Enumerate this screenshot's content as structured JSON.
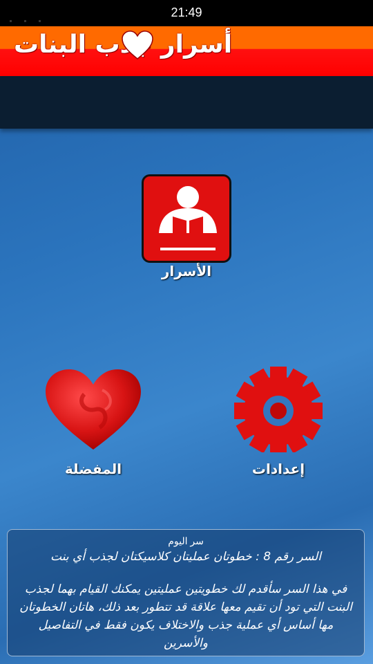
{
  "status_bar": {
    "time": "21:49"
  },
  "app": {
    "title": "أسرار جذب البنات",
    "title_icon": "heart-icon"
  },
  "menu": {
    "secrets": {
      "label": "الأسرار",
      "icon": "reading-person-icon"
    },
    "favorites": {
      "label": "المفضلة",
      "icon": "heart-icon"
    },
    "settings": {
      "label": "إعدادات",
      "icon": "gear-icon"
    }
  },
  "daily_secret": {
    "heading": "سر اليوم",
    "title": "السر رقم 8 : خطوتان عمليتان كلاسيكتان لجذب أي بنت",
    "body": "في هذا السر سأقدم لك خطويتين عمليتين يمكنك القيام بهما لجذب البنت التي تود أن تقيم معها علاقة قد تتطور بعد ذلك، هاتان الخطوتان مها أساس أي عملية جذب والاختلاف يكون فقط في التفاصيل والأسرين"
  },
  "colors": {
    "header_orange": "#ff6a00",
    "header_red": "#ff0000",
    "accent_red": "#e01010",
    "band_dark": "#0b1e31"
  }
}
